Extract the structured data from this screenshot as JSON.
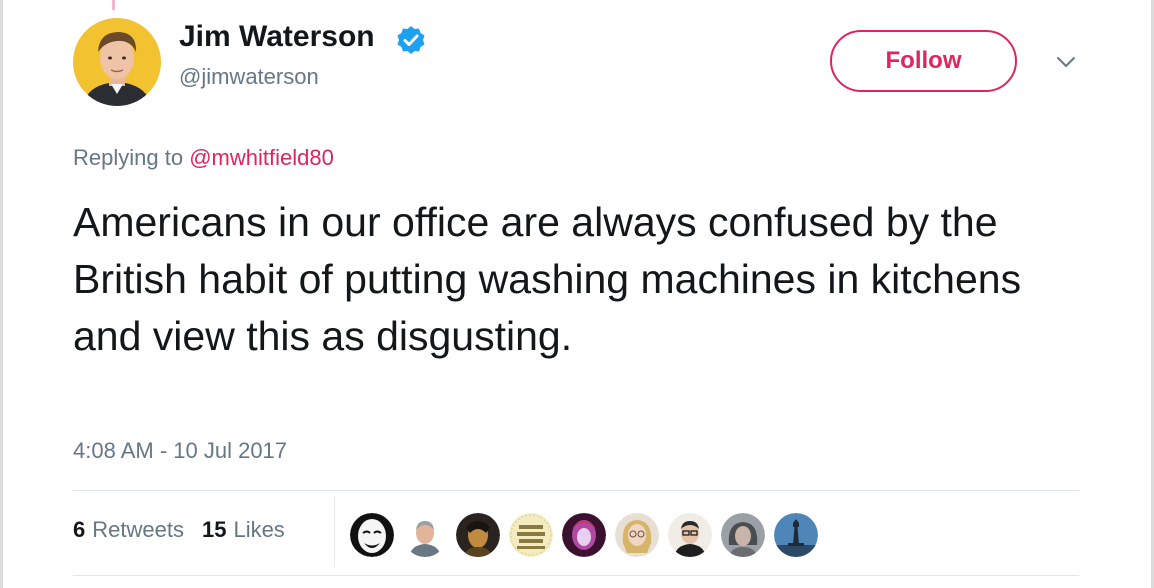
{
  "user": {
    "name": "Jim Waterson",
    "handle": "@jimwaterson",
    "verified": true,
    "avatar_icon": "profile-photo",
    "avatar_bg": "#f2c230"
  },
  "actions": {
    "follow_label": "Follow",
    "menu_icon": "chevron-down-icon"
  },
  "reply": {
    "prefix": "Replying to",
    "mention": "@mwhitfield80"
  },
  "tweet": {
    "text": "Americans in our office are always confused by the British habit of putting washing machines in kitchens and view this as disgusting.",
    "timestamp": "4:08 AM - 10 Jul 2017"
  },
  "stats": {
    "retweets_count": "6",
    "retweets_label": "Retweets",
    "likes_count": "15",
    "likes_label": "Likes"
  },
  "liker_avatars": [
    {
      "name": "mask",
      "bg": "#ffffff",
      "fg": "#111111"
    },
    {
      "name": "man-grey-hair",
      "bg": "#ffffff",
      "fg": "#8a8d90"
    },
    {
      "name": "dark-portrait",
      "bg": "#2a2320",
      "fg": "#d0a850"
    },
    {
      "name": "we-should-all-be-feminists",
      "bg": "#f4ecc0",
      "fg": "#7a6a30"
    },
    {
      "name": "purple-glow",
      "bg": "#3a1230",
      "fg": "#b04aa0"
    },
    {
      "name": "blonde-woman",
      "bg": "#e8dfd4",
      "fg": "#d6b46a"
    },
    {
      "name": "man-glasses",
      "bg": "#f0ece6",
      "fg": "#2a2a2a"
    },
    {
      "name": "grey-woman",
      "bg": "#9aa0a6",
      "fg": "#4a4e52"
    },
    {
      "name": "lighthouse",
      "bg": "#4f86b8",
      "fg": "#1e2a38"
    }
  ],
  "colors": {
    "accent": "#e0245e",
    "verified_blue": "#1da1f2",
    "text_primary": "#14171a",
    "text_secondary": "#657786"
  }
}
